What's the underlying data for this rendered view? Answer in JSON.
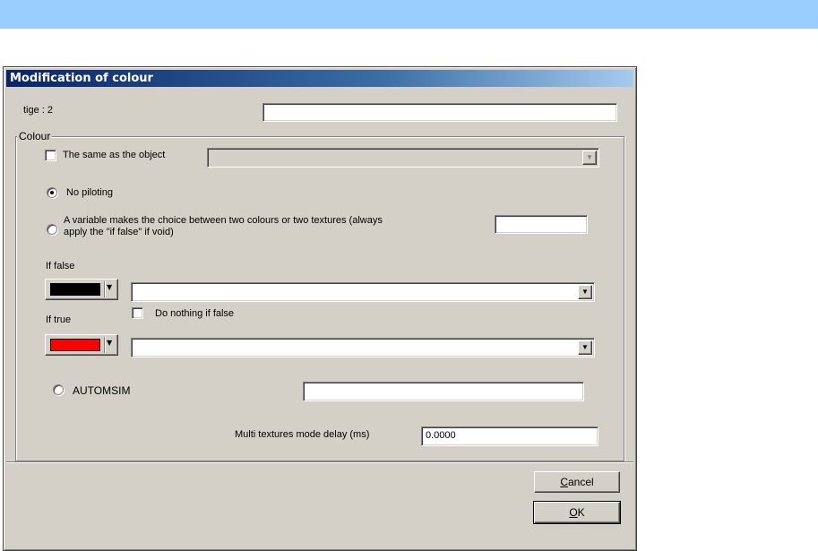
{
  "dialog": {
    "title": "Modification of colour",
    "tige_label": "tige : 2",
    "tige_value": ""
  },
  "colour_group": {
    "legend": "Colour",
    "same_as_object": {
      "label": "The same as the object",
      "checked": false,
      "value": ""
    },
    "no_piloting": {
      "label": "No piloting",
      "checked": true
    },
    "variable_choice": {
      "label_line1": "A variable makes the choice between two colours or two textures (always",
      "label_line2": "apply the \"if false\" if void)",
      "checked": false,
      "value": ""
    },
    "if_false": {
      "label": "If false",
      "color": "#000000",
      "texture_value": ""
    },
    "do_nothing_if_false": {
      "label": "Do nothing if false",
      "checked": false
    },
    "if_true": {
      "label": "If true",
      "color": "#ff0000",
      "texture_value": ""
    },
    "automsim": {
      "label": "AUTOMSIM",
      "checked": false,
      "value": ""
    },
    "multi_textures": {
      "label": "Multi textures mode delay (ms)",
      "value": "0.0000"
    }
  },
  "buttons": {
    "cancel_prefix": "C",
    "cancel_rest": "ancel",
    "ok_prefix": "O",
    "ok_rest": "K"
  },
  "icons": {
    "dropdown": "chevron-down-icon",
    "color_dropdown": "chevron-down-icon"
  }
}
